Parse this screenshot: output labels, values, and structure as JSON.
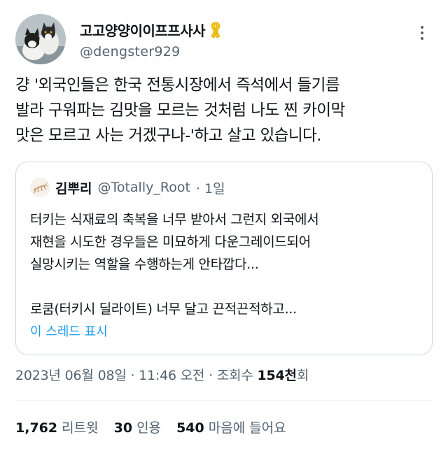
{
  "author": {
    "display_name": "고고양양이이프프사사",
    "handle": "@dengster929",
    "badge_icon": "yellow-ribbon-icon",
    "more_icon": "more-options-icon"
  },
  "tweet": {
    "lines": [
      "걍 '외국인들은 한국 전통시장에서 즉석에서 들기름",
      "발라 구워파는 김맛을 모르는 것처럼 나도 찐 카이막",
      "맛은 모르고 사는 거겠구나-'하고 살고 있습니다."
    ]
  },
  "quote": {
    "display_name": "김뿌리",
    "handle": "@Totally_Root",
    "time": "· 1일",
    "lines": [
      "터키는 식재료의 축복을 너무 받아서 그런지 외국에서",
      "재현을 시도한 경우들은 미묘하게 다운그레이드되어",
      "실망시키는 역할을 수행하는게 안타깝다...",
      "",
      "로쿰(터키시 딜라이트) 너무 달고 끈적끈적하고..."
    ],
    "show_thread": "이 스레드 표시"
  },
  "meta": {
    "datetime": "2023년 06월 08일 · 11:46 오전 · 조회수 ",
    "views": "154천",
    "views_suffix": "회"
  },
  "stats": {
    "retweets_count": "1,762",
    "retweets_label": "리트윗",
    "quotes_count": "30",
    "quotes_label": "인용",
    "likes_count": "540",
    "likes_label": "마음에 들어요"
  },
  "colors": {
    "accent": "#1d9bf0",
    "text": "#0f1419",
    "secondary": "#536471",
    "border": "#cfd9de",
    "ribbon": "#f5c518"
  }
}
